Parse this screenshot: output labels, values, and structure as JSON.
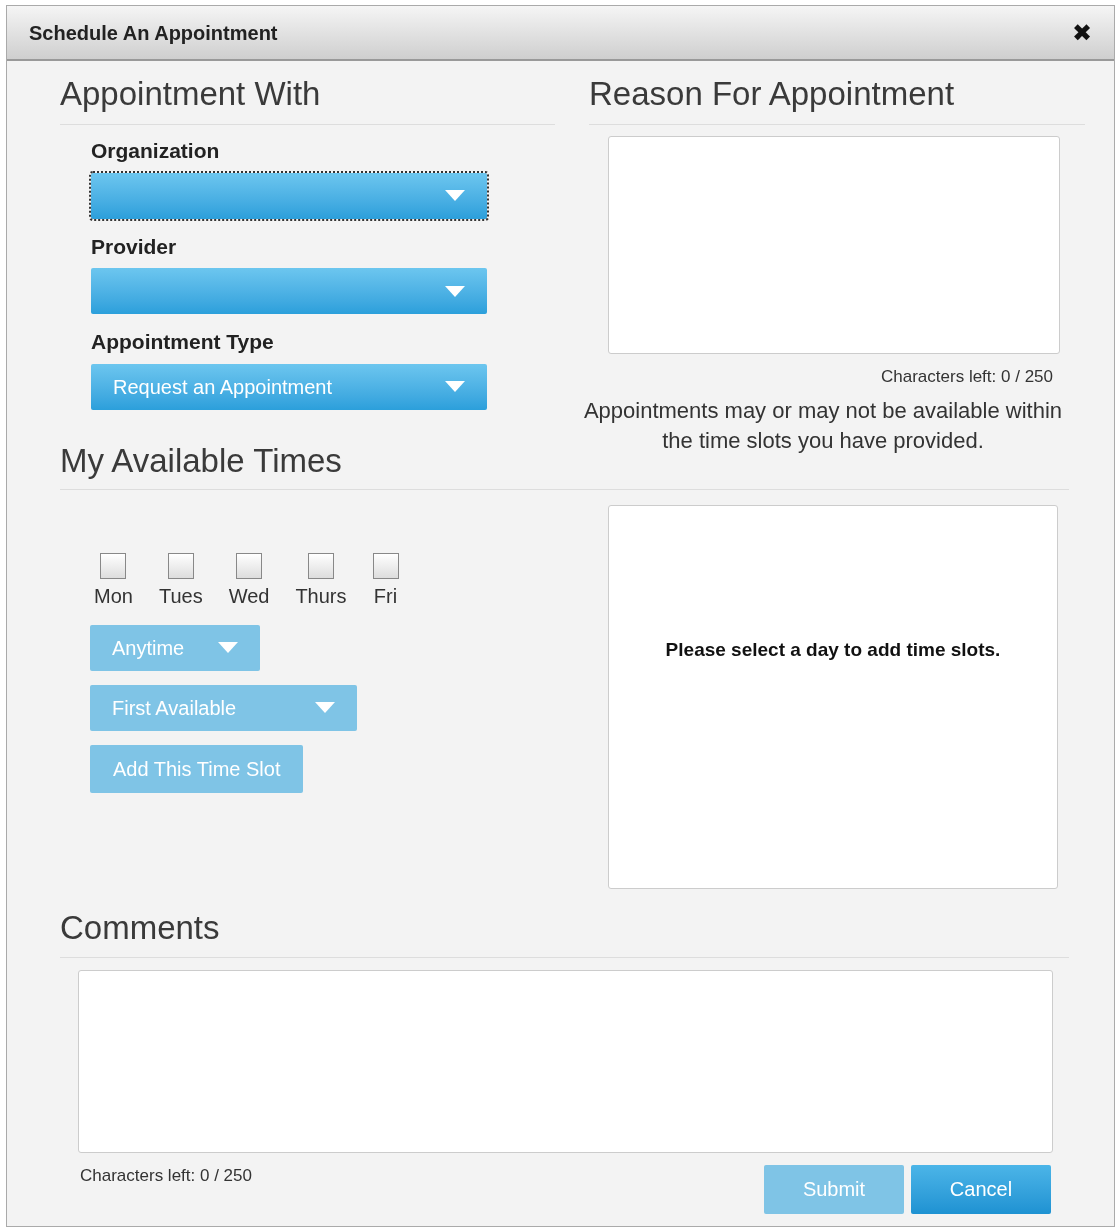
{
  "dialog": {
    "title": "Schedule An Appointment",
    "close": "✖"
  },
  "appointment_with": {
    "heading": "Appointment With",
    "fields": [
      {
        "label": "Organization",
        "focused": true
      },
      {
        "label": "Provider",
        "focused": false
      },
      {
        "label": "Appointment Type",
        "value": "Request an Appointment",
        "focused": false
      }
    ]
  },
  "reason": {
    "heading": "Reason For Appointment",
    "counter": "Characters left: 0 / 250",
    "note": "Appointments may or may not be available within the time slots you have provided."
  },
  "available_times": {
    "heading": "My Available Times",
    "days": [
      {
        "label": "Mon",
        "checked": false
      },
      {
        "label": "Tues",
        "checked": false
      },
      {
        "label": "Wed",
        "checked": false
      },
      {
        "label": "Thurs",
        "checked": false
      },
      {
        "label": "Fri",
        "checked": false
      }
    ],
    "time_select": {
      "value": "Anytime",
      "disabled": true
    },
    "slot_select": {
      "value": "First Available",
      "disabled": true
    },
    "add_button": {
      "label": "Add This Time Slot",
      "disabled": true
    },
    "slots_message": "Please select a day to add time slots."
  },
  "comments": {
    "heading": "Comments",
    "counter": "Characters left: 0 / 250"
  },
  "buttons": [
    {
      "label": "Submit",
      "disabled": true
    },
    {
      "label": "Cancel",
      "disabled": false
    }
  ]
}
